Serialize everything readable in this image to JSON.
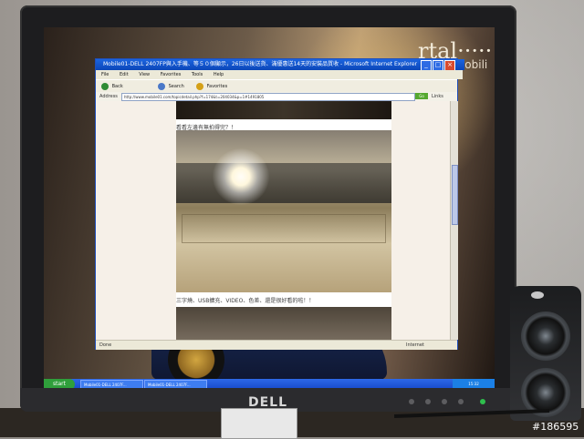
{
  "photo": {
    "brand": "DELL",
    "watermark": "#186595"
  },
  "browser": {
    "title": "Mobile01-DELL 2407FP與入手機、等５０個顯示，26日以後送貨、滿優惠送14天的安裝品質收 - Microsoft Internet Explorer",
    "menu": [
      "File",
      "Edit",
      "View",
      "Favorites",
      "Tools",
      "Help"
    ],
    "toolbar": {
      "back": "Back",
      "search": "Search",
      "favorites": "Favorites"
    },
    "address": {
      "label": "Address",
      "value": "http://www.mobile01.com/topicdetail.php?f=174&t=204034&p=1#1491805",
      "go": "Go",
      "links": "Links"
    },
    "content": {
      "line_1": "看看左邊有無拍得完？！",
      "line_2": "三字燒、USB擴充、VIDEO、色差、還是很好看的啦！！"
    },
    "status": {
      "left": "Done",
      "right": "Internet"
    }
  },
  "wallpaper": {
    "brand_text": "rtal·····",
    "sub_text": "hr/automobili"
  },
  "taskbar": {
    "start": "start",
    "items": [
      "Mobile01-DELL 2407F...",
      "Mobile01-DELL 2407F..."
    ],
    "clock": "15:32"
  }
}
